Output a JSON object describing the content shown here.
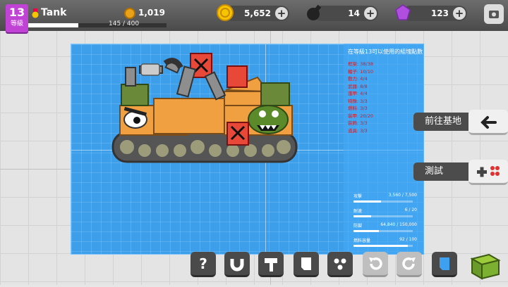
{
  "player": {
    "level": "13",
    "level_label": "等級",
    "name": "Tank",
    "coins": "1,019",
    "xp_text": "145 / 400",
    "xp_fraction": 0.36
  },
  "currency": {
    "gold": "5,652",
    "ammo": "14",
    "gems": "123"
  },
  "blueprint": {
    "header": "在等級13可以使用的組塊點數",
    "requirements": [
      "框架: 38/38",
      "輪子: 10/10",
      "動力: 4/4",
      "武器: 8/8",
      "護甲: 4/4",
      "特殊: 3/3",
      "燃料: 3/3",
      "裝甲: 20/20",
      "裝飾: 3/3",
      "道具: 3/3"
    ],
    "stats": [
      {
        "label": "攻擊",
        "value": "3,560 / 7,500",
        "fraction": 0.47
      },
      {
        "label": "耐速",
        "value": "6 / 20",
        "fraction": 0.3
      },
      {
        "label": "防禦",
        "value": "64,840 / 150,000",
        "fraction": 0.43
      },
      {
        "label": "燃料容量",
        "value": "92 / 100",
        "fraction": 0.92
      }
    ]
  },
  "buttons": {
    "go_base": "前往基地",
    "test": "測試"
  },
  "toolbar": [
    "?",
    "",
    "",
    "",
    "",
    "",
    "",
    "",
    ""
  ],
  "colors": {
    "blueprint": "#3d9fea",
    "level_badge": "#c043d6",
    "tank_orange": "#f0a040",
    "tank_green": "#6a8a3a"
  }
}
